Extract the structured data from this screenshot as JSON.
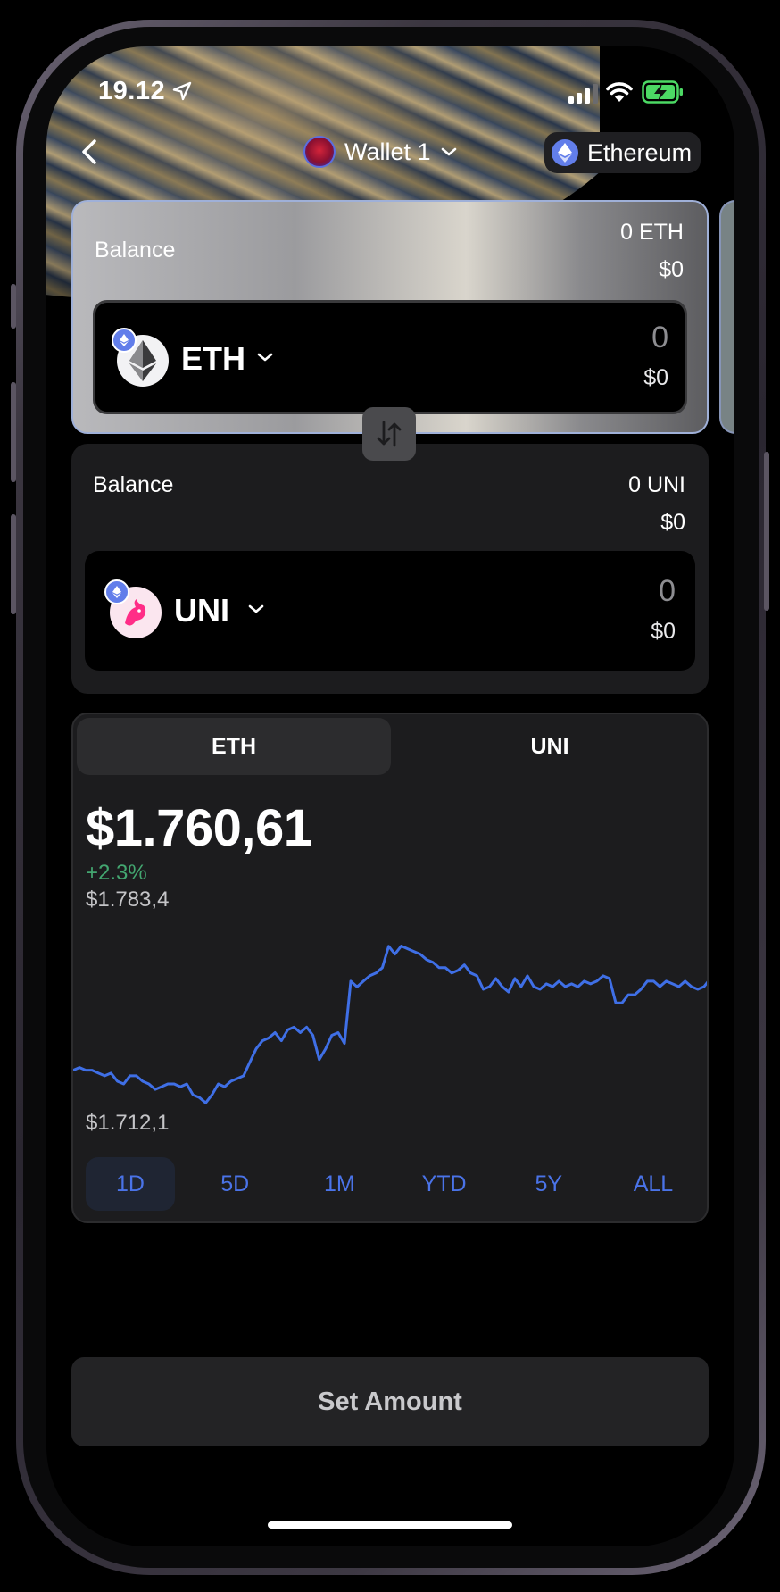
{
  "status_bar": {
    "time": "19.12"
  },
  "nav": {
    "wallet_name": "Wallet 1",
    "network": "Ethereum"
  },
  "from": {
    "balance_label": "Balance",
    "balance_token": "0 ETH",
    "balance_usd": "$0",
    "token_symbol": "ETH",
    "amount": "0",
    "amount_usd": "$0"
  },
  "to": {
    "balance_label": "Balance",
    "balance_token": "0 UNI",
    "balance_usd": "$0",
    "token_symbol": "UNI",
    "amount": "0",
    "amount_usd": "$0"
  },
  "chart": {
    "tabs": [
      "ETH",
      "UNI"
    ],
    "active_tab": "ETH",
    "price": "$1.760,61",
    "change": "+2.3%",
    "high": "$1.783,4",
    "low": "$1.712,1",
    "ranges": [
      "1D",
      "5D",
      "1M",
      "YTD",
      "5Y",
      "ALL"
    ],
    "active_range": "1D",
    "line_color": "#3f6fe6"
  },
  "chart_data": {
    "type": "line",
    "y_min": 1712.1,
    "y_max": 1783.4,
    "y_max_label": "$1.783,4",
    "y_min_label": "$1.712,1",
    "values": [
      1726.9,
      1728.1,
      1726.9,
      1726.9,
      1725.6,
      1724.4,
      1725.6,
      1722.0,
      1720.8,
      1724.4,
      1724.4,
      1722.0,
      1720.8,
      1718.4,
      1719.6,
      1720.8,
      1720.8,
      1719.6,
      1720.8,
      1716.0,
      1714.8,
      1712.4,
      1716.0,
      1720.8,
      1719.6,
      1722.0,
      1723.2,
      1724.4,
      1730.4,
      1736.4,
      1740.0,
      1741.2,
      1743.6,
      1740.0,
      1744.8,
      1746.0,
      1743.6,
      1746.0,
      1742.4,
      1731.6,
      1736.4,
      1742.4,
      1743.6,
      1738.8,
      1766.4,
      1763.9,
      1766.4,
      1768.8,
      1770.0,
      1772.4,
      1781.9,
      1778.4,
      1782.0,
      1780.8,
      1779.6,
      1778.4,
      1776.0,
      1774.8,
      1772.4,
      1772.4,
      1770.0,
      1771.2,
      1773.6,
      1770.0,
      1768.8,
      1762.8,
      1764.0,
      1767.6,
      1764.0,
      1761.6,
      1767.6,
      1764.0,
      1768.8,
      1764.0,
      1762.8,
      1765.2,
      1764.0,
      1766.4,
      1764.0,
      1765.2,
      1763.9,
      1766.4,
      1765.2,
      1766.4,
      1768.8,
      1767.6,
      1756.8,
      1756.8,
      1760.4,
      1760.4,
      1762.8,
      1766.4,
      1766.4,
      1764.0,
      1766.4,
      1765.2,
      1764.0,
      1766.4,
      1764.0,
      1762.8,
      1764.0,
      1767.6
    ]
  },
  "cta": {
    "label": "Set Amount"
  }
}
